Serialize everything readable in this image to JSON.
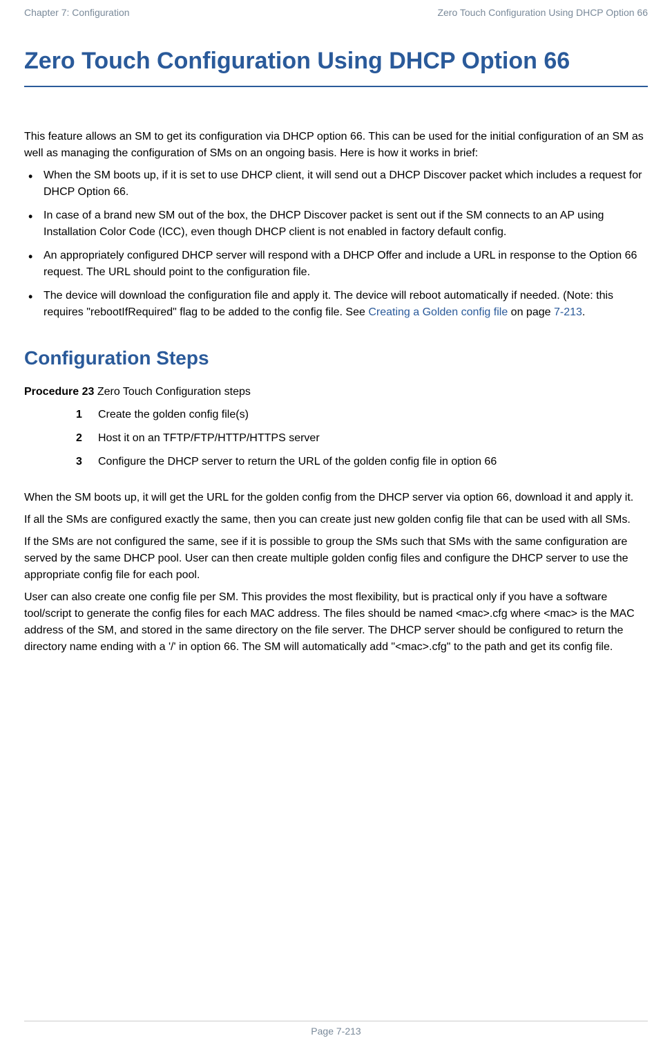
{
  "header": {
    "left": "Chapter 7:  Configuration",
    "right": "Zero Touch Configuration Using DHCP Option 66"
  },
  "title": "Zero Touch Configuration Using DHCP Option 66",
  "intro": "This feature allows an SM to get its configuration via DHCP option 66. This can be used for the initial configuration of an SM as well as managing the configuration of SMs on an ongoing basis. Here is how it works in brief:",
  "bullets": {
    "b1": "When the SM boots up, if it is set to use DHCP client, it will send out a DHCP Discover packet which includes a request for DHCP Option 66.",
    "b2": "In case of a brand new SM out of the box, the DHCP Discover packet is sent out if the SM connects to an AP using Installation Color Code (ICC), even though DHCP client is not enabled in factory default config.",
    "b3": "An appropriately configured DHCP server will respond with a DHCP Offer and include a URL in response to the Option 66 request. The URL should point to the configuration file.",
    "b4_pre": "The device will download the configuration file and apply it. The device will reboot automatically if needed. (Note: this requires \"rebootIfRequired\" flag to be added to the config file. See ",
    "b4_link": "Creating a Golden config file",
    "b4_mid": " on page ",
    "b4_page": "7-213",
    "b4_post": "."
  },
  "section2_title": "Configuration Steps",
  "procedure": {
    "label_bold": "Procedure 23",
    "label_rest": " Zero Touch Configuration steps",
    "steps": {
      "n1": "1",
      "s1": "Create the golden config file(s)",
      "n2": "2",
      "s2": "Host it on an TFTP/FTP/HTTP/HTTPS server",
      "n3": "3",
      "s3": "Configure the DHCP server to return the URL of the golden config file in option 66"
    }
  },
  "paras": {
    "p1": "When the SM boots up, it will get the URL for the golden config from the DHCP server via option 66, download it and apply it.",
    "p2": "If all the SMs are configured exactly the same, then you can create just new golden config file that can be used with all SMs.",
    "p3": "If the SMs are not configured the same, see if it is possible to group the SMs such that SMs with the same configuration are served by the same DHCP pool. User can then create multiple golden config files and configure the DHCP server to use the appropriate config file for each pool.",
    "p4": "User can also create one config file per SM. This provides the most flexibility, but is practical only if you have a software tool/script to generate the config files for each MAC address. The files should be named <mac>.cfg where <mac> is the MAC address of the SM, and stored in the same directory on the file server. The DHCP server should be configured to return the directory name ending with a '/' in option 66. The SM will automatically add \"<mac>.cfg\" to the path and get its config file."
  },
  "footer": "Page 7-213"
}
